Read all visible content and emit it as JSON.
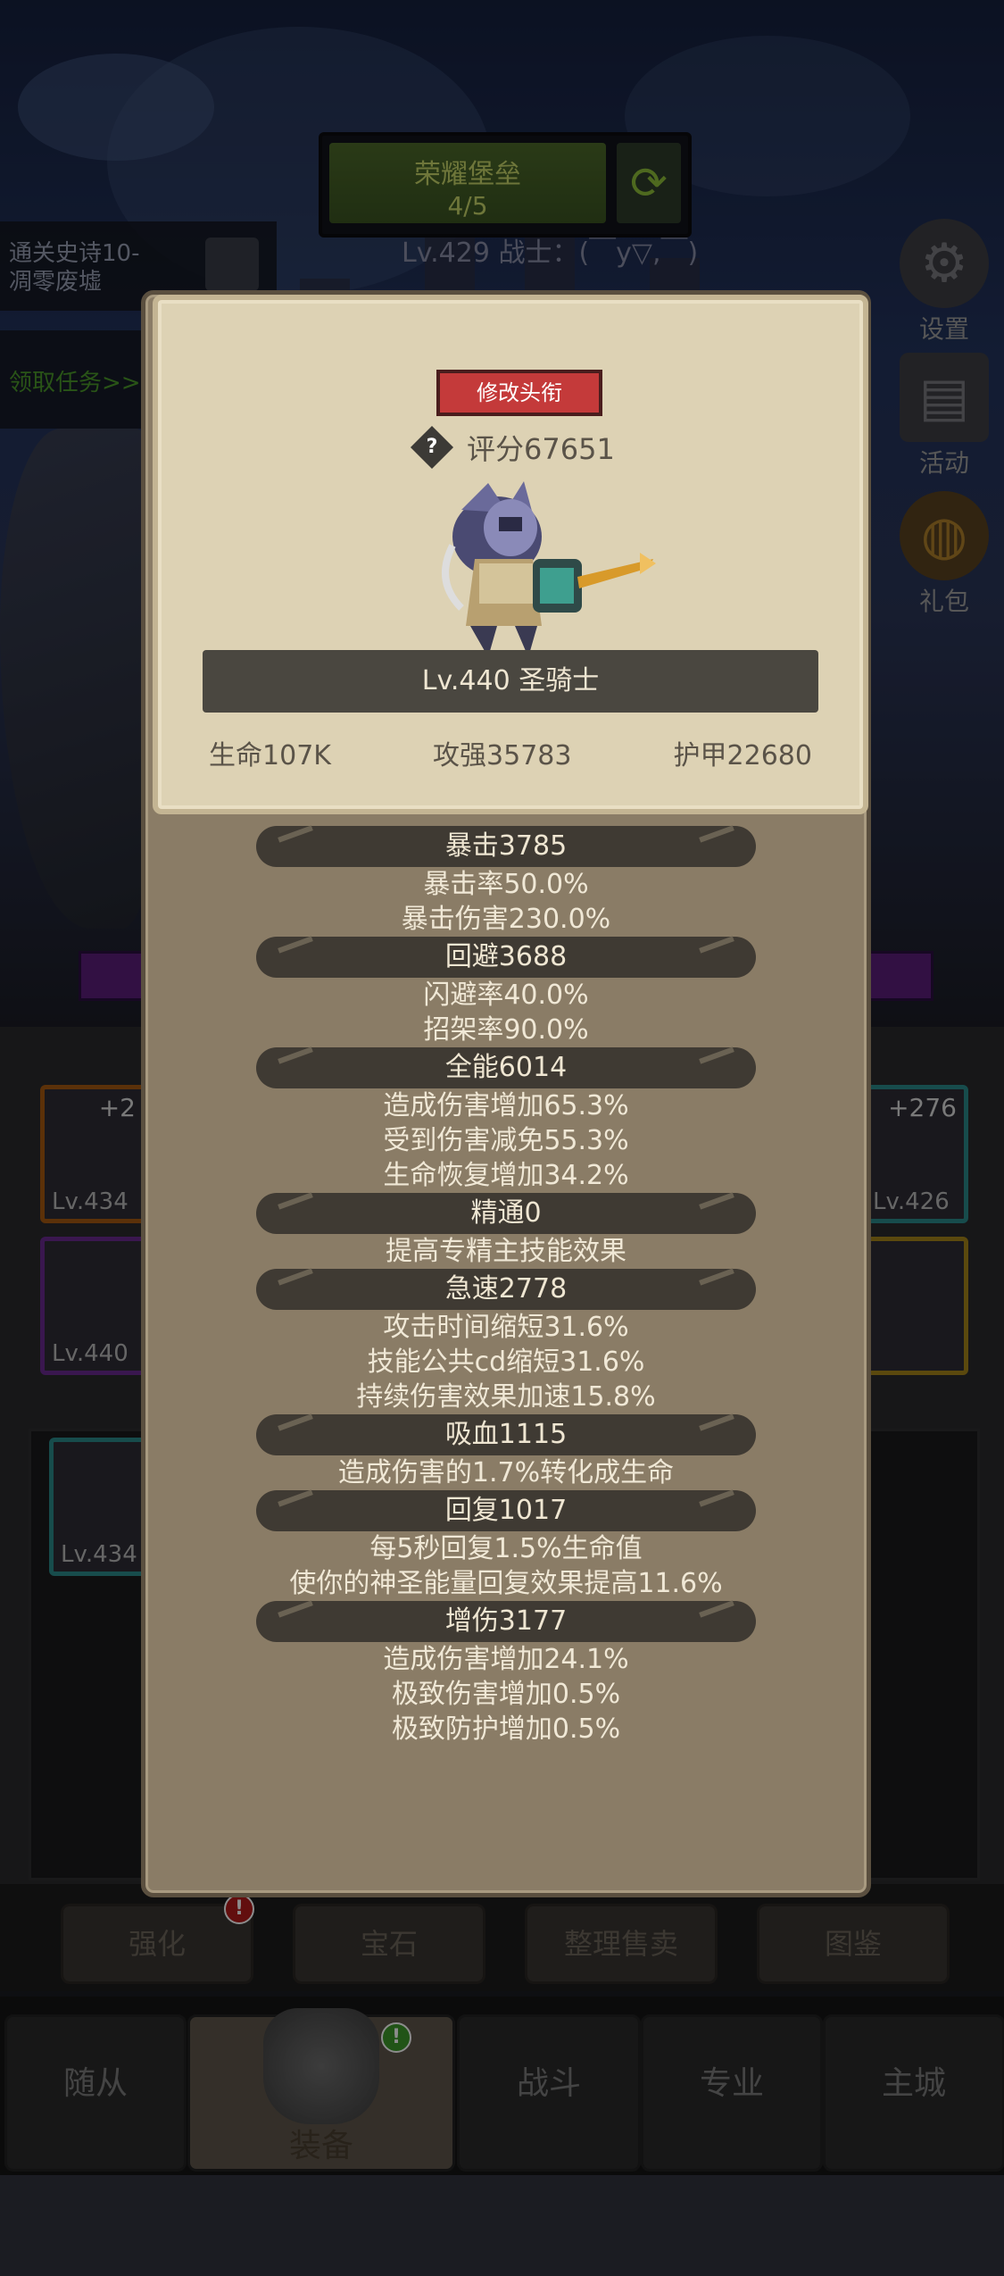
{
  "hud": {
    "stage_name": "荣耀堡垒",
    "stage_progress": "4/5",
    "player_line": "Lv.429 战士：(￣y▽,￣)",
    "quest_text_1": "通关史诗10-",
    "quest_text_2": "凋零废墟",
    "task_text": "领取任务>>",
    "side_buttons": [
      {
        "label": "设置",
        "icon": "gear-icon"
      },
      {
        "label": "活动",
        "icon": "scroll-icon"
      },
      {
        "label": "礼包",
        "icon": "gift-icon"
      }
    ]
  },
  "background_slots": [
    {
      "plus": "+2",
      "level": "Lv.434"
    },
    {
      "plus": "",
      "level": "Lv.440"
    },
    {
      "plus": "+276",
      "level": "Lv.426"
    },
    {
      "plus": "",
      "level": "Lv.434"
    }
  ],
  "card": {
    "title_button": "修改头衔",
    "score": "评分67651",
    "character": "Lv.440 圣骑士",
    "hp": "生命107K",
    "attack": "攻强35783",
    "armor": "护甲22680"
  },
  "stat_groups": [
    {
      "head": "暴击3785",
      "lines": [
        "暴击率50.0%",
        "暴击伤害230.0%"
      ]
    },
    {
      "head": "回避3688",
      "lines": [
        "闪避率40.0%",
        "招架率90.0%"
      ]
    },
    {
      "head": "全能6014",
      "lines": [
        "造成伤害增加65.3%",
        "受到伤害减免55.3%",
        "生命恢复增加34.2%"
      ]
    },
    {
      "head": "精通0",
      "lines": [
        "提高专精主技能效果"
      ]
    },
    {
      "head": "急速2778",
      "lines": [
        "攻击时间缩短31.6%",
        "技能公共cd缩短31.6%",
        "持续伤害效果加速15.8%"
      ]
    },
    {
      "head": "吸血1115",
      "lines": [
        "造成伤害的1.7%转化成生命"
      ]
    },
    {
      "head": "回复1017",
      "lines": [
        "每5秒回复1.5%生命值",
        "使你的神圣能量回复效果提高11.6%"
      ]
    },
    {
      "head": "增伤3177",
      "lines": [
        "造成伤害增加24.1%",
        "极致伤害增加0.5%",
        "极致防护增加0.5%"
      ]
    }
  ],
  "sub_tabs": [
    {
      "label": "强化",
      "badge": "!"
    },
    {
      "label": "宝石"
    },
    {
      "label": "整理售卖"
    },
    {
      "label": "图鉴"
    }
  ],
  "main_tabs": [
    {
      "label": "随从"
    },
    {
      "label": "装备",
      "badge": "!"
    },
    {
      "label": "战斗"
    },
    {
      "label": "专业"
    },
    {
      "label": "主城"
    }
  ],
  "colors": {
    "title_button": "#c43a3a",
    "card_bg": "#ddd2b4",
    "panel_bg": "#8a7c66"
  }
}
